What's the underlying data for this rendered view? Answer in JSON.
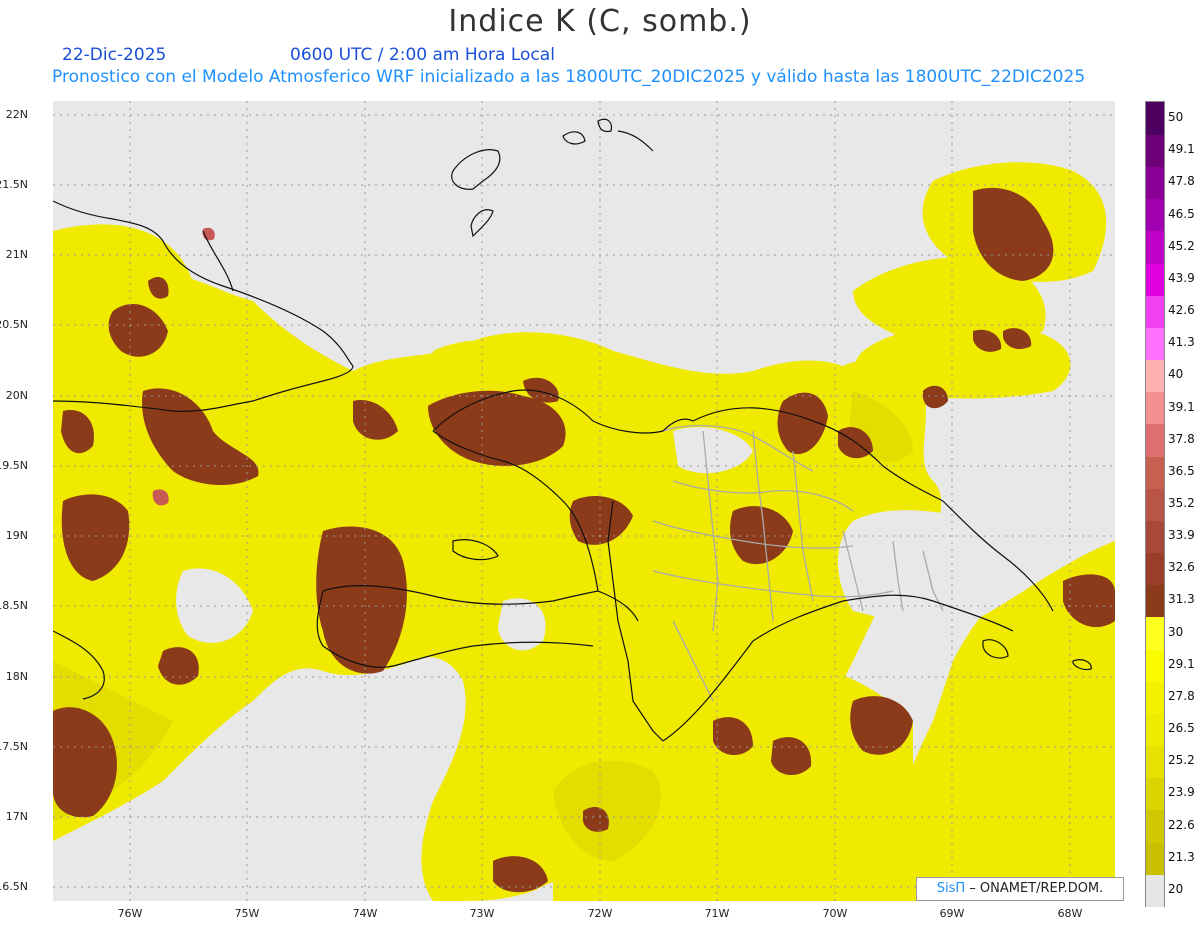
{
  "title": "Indice K (C, somb.)",
  "date": "22-Dic-2025",
  "time_label": "0600 UTC / 2:00 am Hora Local",
  "forecast_label": "Pronostico con el Modelo Atmosferico WRF inicializado a las 1800UTC_20DIC2025 y válido hasta las  1800UTC_22DIC2025",
  "credit": {
    "logo": "SisΠ",
    "text": "– ONAMET/REP.DOM."
  },
  "lat_labels": [
    "22N",
    "21.5N",
    "21N",
    "20.5N",
    "20N",
    "19.5N",
    "19N",
    "18.5N",
    "18N",
    "17.5N",
    "17N",
    "16.5N"
  ],
  "lon_labels": [
    "76W",
    "75W",
    "74W",
    "73W",
    "72W",
    "71W",
    "70W",
    "69W",
    "68W"
  ],
  "colorbar": {
    "labels": [
      "20",
      "21.3",
      "22.6",
      "23.9",
      "25.2",
      "26.5",
      "27.8",
      "29.1",
      "30",
      "31.3",
      "32.6",
      "33.9",
      "35.2",
      "36.5",
      "37.8",
      "39.1",
      "40",
      "41.3",
      "42.6",
      "43.9",
      "45.2",
      "46.5",
      "47.8",
      "49.1",
      "50"
    ],
    "colors": [
      "#e6e6e6",
      "#c8c000",
      "#d0c800",
      "#dcd400",
      "#e8e000",
      "#eeea00",
      "#f4f000",
      "#fafa00",
      "#ffff20",
      "#8b3a1a",
      "#9a3e2a",
      "#a8483a",
      "#b85548",
      "#c86052",
      "#e07070",
      "#f59090",
      "#ffb0b0",
      "#ff70ff",
      "#f040f0",
      "#e000e0",
      "#c000c8",
      "#a000b0",
      "#8a0096",
      "#6e0078",
      "#4e0060"
    ]
  },
  "colors": {
    "background": "#e8e8e8",
    "low_k": "#dede00",
    "mid_k": "#f4f000",
    "high_k": "#8b3a1a",
    "coast": "#111111",
    "provinces": "#aaaaaa"
  }
}
